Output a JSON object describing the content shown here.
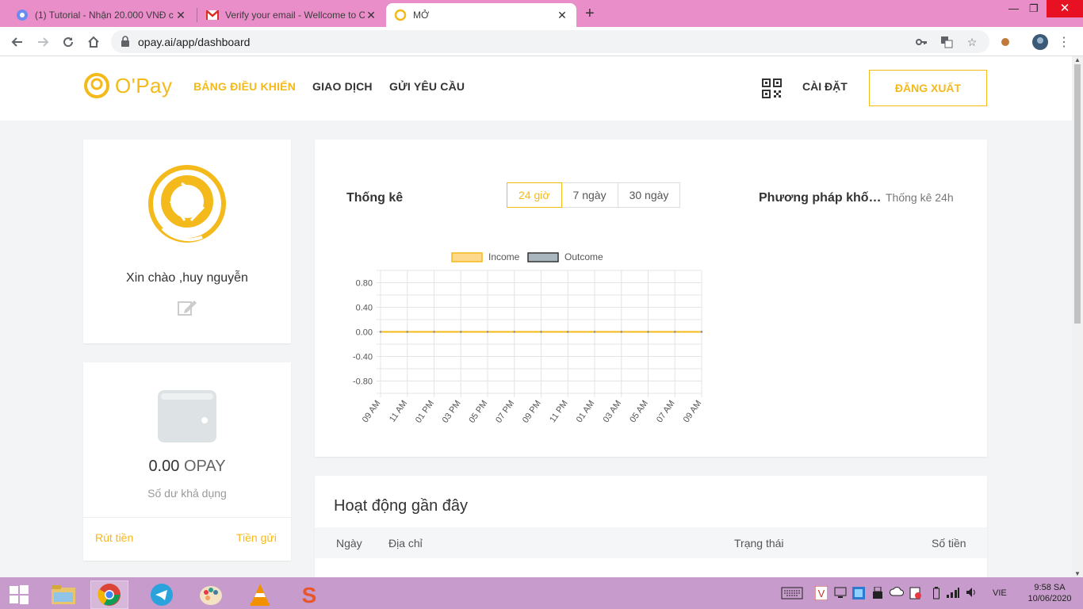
{
  "browser": {
    "tabs": [
      {
        "title": "(1) Tutorial - Nhận 20.000 VNĐ c",
        "icon": "messenger-icon"
      },
      {
        "title": "Verify your email - Wellcome to C",
        "icon": "gmail-icon"
      },
      {
        "title": "MỞ",
        "icon": "opay-icon",
        "active": true
      }
    ],
    "url": "opay.ai/app/dashboard"
  },
  "header": {
    "logo": "O'Pay",
    "nav": [
      "BẢNG ĐIỀU KHIỂN",
      "GIAO DỊCH",
      "GỬI YÊU CẦU"
    ],
    "settings": "CÀI ĐẶT",
    "logout": "ĐĂNG XUẤT"
  },
  "profile": {
    "greeting": "Xin chào ,huy nguyễn"
  },
  "wallet": {
    "amount": "0.00",
    "unit": "OPAY",
    "available_label": "Số dư khả dụng",
    "withdraw": "Rút tiền",
    "deposit": "Tiền gửi"
  },
  "stats": {
    "title": "Thống kê",
    "ranges": [
      "24 giờ",
      "7 ngày",
      "30 ngày"
    ],
    "selected_range": "24 giờ",
    "method_label": "Phương pháp khối l...",
    "method_value": "Thống kê 24h"
  },
  "chart_data": {
    "type": "line",
    "legend_position": "top",
    "grid": true,
    "x": [
      "09 AM",
      "11 AM",
      "01 PM",
      "03 PM",
      "05 PM",
      "07 PM",
      "09 PM",
      "11 PM",
      "01 AM",
      "03 AM",
      "05 AM",
      "07 AM",
      "09 AM"
    ],
    "y_ticks": [
      "0.80",
      "0.40",
      "0.00",
      "-0.40",
      "-0.80"
    ],
    "ylim": [
      -1.0,
      1.0
    ],
    "series": [
      {
        "name": "Income",
        "color": "#fcd98c",
        "values": [
          0,
          0,
          0,
          0,
          0,
          0,
          0,
          0,
          0,
          0,
          0,
          0,
          0
        ]
      },
      {
        "name": "Outcome",
        "color": "#a9b6bd",
        "values": [
          0,
          0,
          0,
          0,
          0,
          0,
          0,
          0,
          0,
          0,
          0,
          0,
          0
        ]
      }
    ]
  },
  "recent": {
    "title": "Hoạt động gần đây",
    "columns": [
      "Ngày",
      "Địa chỉ",
      "Trạng thái",
      "Số tiền"
    ]
  },
  "taskbar": {
    "lang": "VIE",
    "time": "9:58 SA",
    "date": "10/06/2020"
  },
  "colors": {
    "accent": "#f4b91a",
    "tabstrip": "#e98ec9",
    "taskbar": "#c79bcb"
  }
}
